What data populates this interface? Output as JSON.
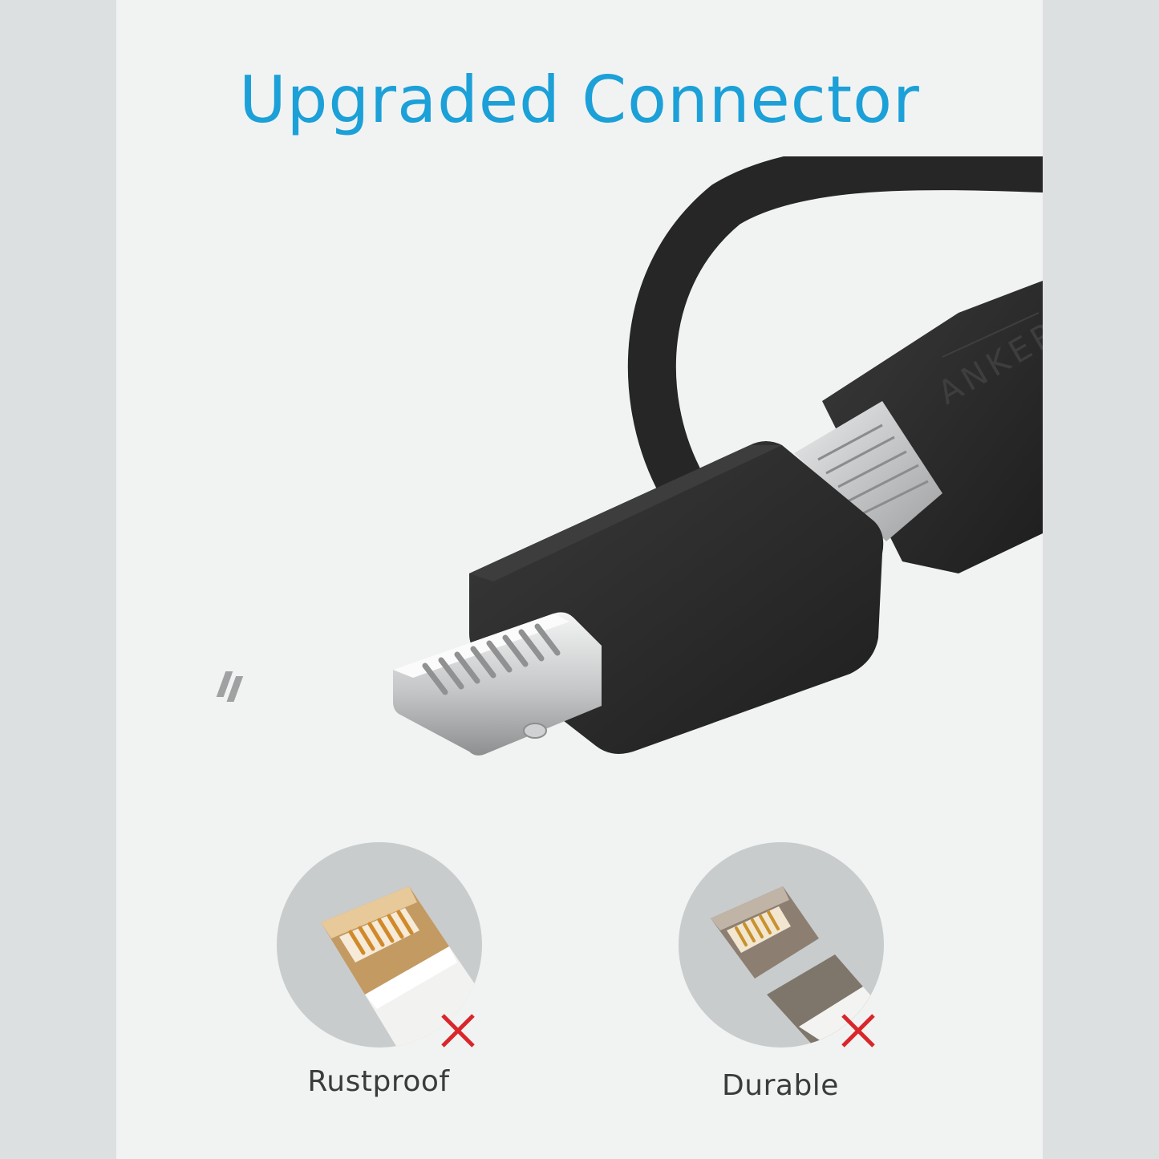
{
  "title": "Upgraded Connector",
  "brand_mark": "ANKER",
  "features": [
    {
      "label": "Rustproof",
      "mark_icon": "red-x-icon"
    },
    {
      "label": "Durable",
      "mark_icon": "red-x-icon"
    }
  ],
  "colors": {
    "title": "#1ca0d8",
    "cable": "#2b2b2b",
    "metal": "#c9cbcc",
    "cross": "#d9262b"
  }
}
